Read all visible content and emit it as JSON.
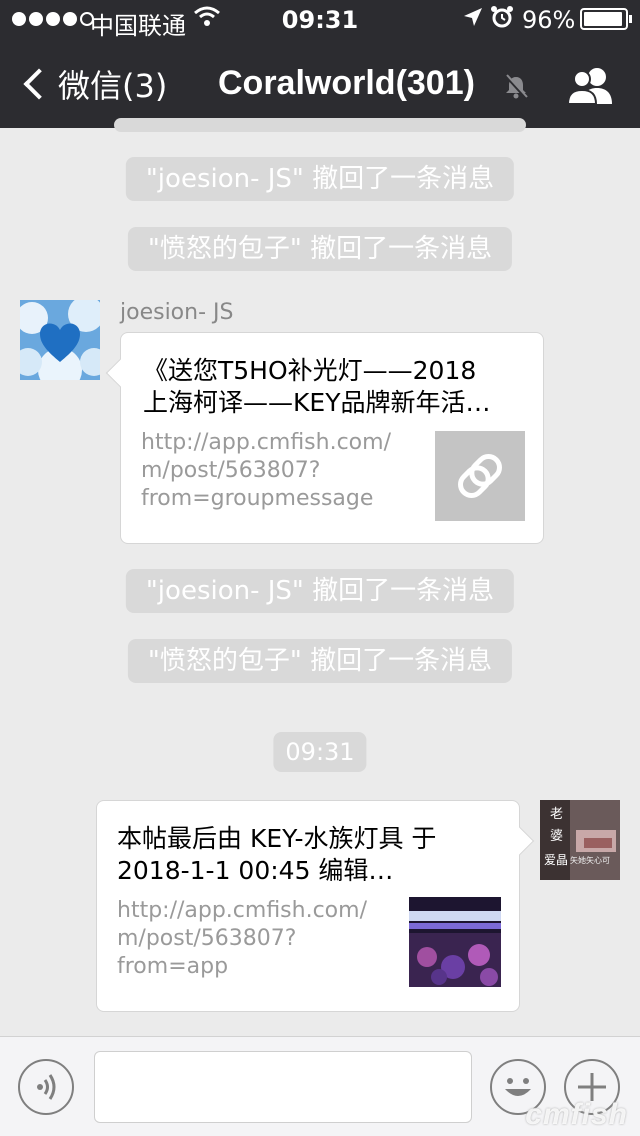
{
  "status_bar": {
    "carrier": "中国联通",
    "time": "09:31",
    "battery_pct": "96%"
  },
  "nav": {
    "back_label": "微信(3)",
    "title": "Coralworld(301)"
  },
  "messages": {
    "recall1": "\"joesion- JS\" 撤回了一条消息",
    "recall2": "\"愤怒的包子\" 撤回了一条消息",
    "sender_name": "joesion- JS",
    "card1": {
      "title_line1": "《送您T5HO补光灯——2018",
      "title_line2": "上海柯译——KEY品牌新年活…",
      "url_line1": "http://app.cmfish.com/",
      "url_line2": "m/post/563807?",
      "url_line3": "from=groupmessage"
    },
    "recall3": "\"joesion- JS\" 撤回了一条消息",
    "recall4": "\"愤怒的包子\" 撤回了一条消息",
    "timestamp": "09:31",
    "card2": {
      "title_line1": "本帖最后由 KEY-水族灯具 于",
      "title_line2": "2018-1-1 00:45 编辑…",
      "url_line1": "http://app.cmfish.com/",
      "url_line2": "m/post/563807?",
      "url_line3": "from=app"
    },
    "my_avatar_text1": "老",
    "my_avatar_text2": "婆",
    "my_avatar_text3": "爱晶",
    "my_avatar_text4": "矢她矢心可"
  },
  "watermark": "cmfish",
  "colors": {
    "nav_bg": "#2c2c30",
    "chat_bg": "#ebebeb",
    "system_pill": "#d9d9d9"
  }
}
